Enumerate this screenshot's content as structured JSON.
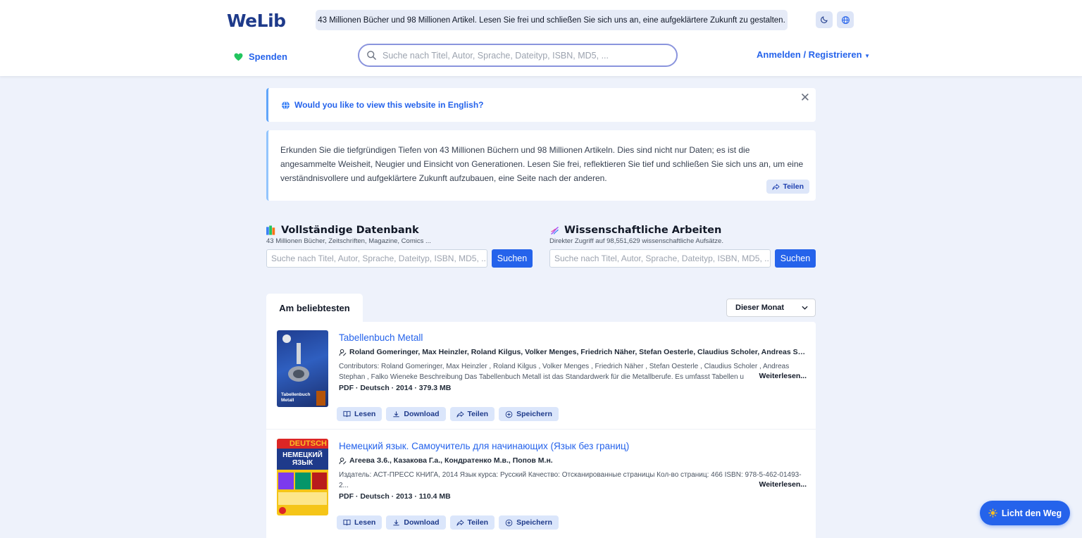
{
  "header": {
    "logo": "WeLib",
    "tagline": "43 Millionen Bücher und 98 Millionen Artikel. Lesen Sie frei und schließen Sie sich uns an, eine aufgeklärtere Zukunft zu gestalten.",
    "donate_label": "Spenden",
    "search_placeholder": "Suche nach Titel, Autor, Sprache, Dateityp, ISBN, MD5, ...",
    "login_label": "Anmelden / Registrieren",
    "icons": [
      "moon-icon",
      "globe-icon"
    ]
  },
  "banner": {
    "language_prompt": "Would you like to view this website in English?",
    "close_symbol": "✕"
  },
  "intro": {
    "text": "Erkunden Sie die tiefgründigen Tiefen von 43 Millionen Büchern und 98 Millionen Artikeln. Dies sind nicht nur Daten; es ist die angesammelte Weisheit, Neugier und Einsicht von Generationen. Lesen Sie frei, reflektieren Sie tief und schließen Sie sich uns an, um eine verständnisvollere und aufgeklärtere Zukunft aufzubauen, eine Seite nach der anderen.",
    "share_label": "Teilen"
  },
  "databases": [
    {
      "title": "Vollständige Datenbank",
      "subtitle": "43 Millionen Bücher, Zeitschriften, Magazine, Comics ...",
      "placeholder": "Suche nach Titel, Autor, Sprache, Dateityp, ISBN, MD5, ...",
      "button": "Suchen"
    },
    {
      "title": "Wissenschaftliche Arbeiten",
      "subtitle": "Direkter Zugriff auf 98,551,629 wissenschaftliche Aufsätze.",
      "placeholder": "Suche nach Titel, Autor, Sprache, Dateityp, ISBN, MD5, ...",
      "button": "Suchen"
    }
  ],
  "popular": {
    "tab_label": "Am beliebtesten",
    "period_selected": "Dieser Monat",
    "items": [
      {
        "title": "Tabellenbuch Metall",
        "authors": "Roland Gomeringer, Max Heinzler, Roland Kilgus, Volker Menges, Friedrich Näher, Stefan Oesterle, Claudius Scholer, Andreas Stephan...",
        "description": "Contributors: Roland Gomeringer, Max Heinzler , Roland Kilgus , Volker Menges , Friedrich Näher , Stefan Oesterle , Claudius Scholer , Andreas Stephan , Falko Wieneke Beschreibung Das Tabellenbuch Metall ist das Standardwerk für die Metallberufe. Es umfasst Tabellen u",
        "more_label": "Weiterlesen...",
        "meta": "PDF · Deutsch · 2014 · 379.3 MB",
        "cover_text": "Tabellenbuch Metall"
      },
      {
        "title": "Немецкий язык. Самоучитель для начинающих (Язык без границ)",
        "authors": "Агеева З.6., Казакова Г.а., Кондратенко М.в., Попов М.н.",
        "description": "Издатель: АСТ-ПРЕСС КНИГА, 2014 Язык курса: Русский Качество: Отсканированные страницы Кол-во страниц: 466 ISBN: 978-5-462-01493-2...",
        "more_label": "Weiterlesen...",
        "meta": "PDF · Deutsch · 2013 · 110.4 MB",
        "cover_text_top": "DEUTSCH",
        "cover_text_main": "НЕМЕЦКИЙ ЯЗЫК"
      }
    ],
    "actions": [
      "Lesen",
      "Download",
      "Teilen",
      "Speichern"
    ]
  },
  "fab_label": "Licht den Weg",
  "colors": {
    "accent": "#2563eb",
    "logo": "#1e3a8a",
    "page_bg": "#eef2fb"
  }
}
